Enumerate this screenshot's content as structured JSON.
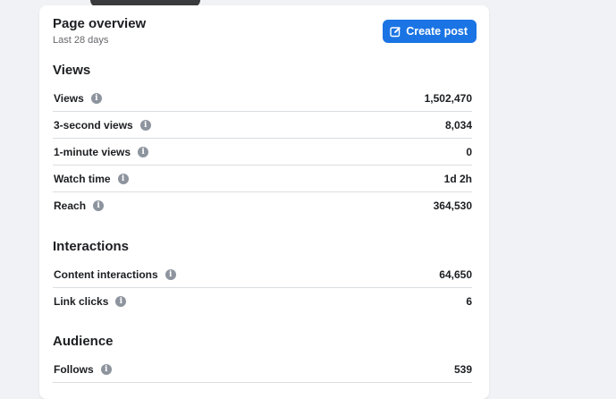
{
  "header": {
    "title": "Page overview",
    "subtitle": "Last 28 days",
    "create_button_label": "Create post"
  },
  "sections": [
    {
      "title": "Views",
      "rows": [
        {
          "label": "Views",
          "value": "1,502,470"
        },
        {
          "label": "3-second views",
          "value": "8,034"
        },
        {
          "label": "1-minute views",
          "value": "0"
        },
        {
          "label": "Watch time",
          "value": "1d 2h"
        },
        {
          "label": "Reach",
          "value": "364,530"
        }
      ]
    },
    {
      "title": "Interactions",
      "rows": [
        {
          "label": "Content interactions",
          "value": "64,650"
        },
        {
          "label": "Link clicks",
          "value": "6"
        }
      ]
    },
    {
      "title": "Audience",
      "rows": [
        {
          "label": "Follows",
          "value": "539"
        }
      ]
    }
  ],
  "icons": {
    "info": "info-icon",
    "create": "edit-icon"
  },
  "colors": {
    "accent": "#1b74e4",
    "background": "#f0f2f5",
    "info_icon": "#8d949e"
  }
}
